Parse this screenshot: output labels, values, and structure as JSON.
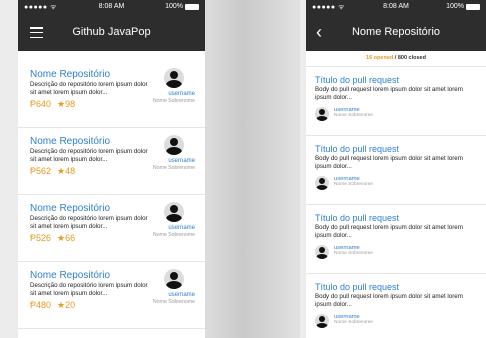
{
  "status": {
    "carrier": "●●●●● ᯤ",
    "time": "8:08 AM",
    "battery": "100%"
  },
  "left_screen": {
    "title": "Github JavaPop",
    "repos": [
      {
        "name": "Nome Repositório",
        "description": "Descrição do repositório lorem ipsum dolor sit amet lorem ipsum dolor...",
        "forks": "640",
        "stars": "98",
        "username": "username",
        "fullname": "Nome Sobrenome"
      },
      {
        "name": "Nome Repositório",
        "description": "Descrição do repositório lorem ipsum dolor sit amet lorem ipsum dolor...",
        "forks": "562",
        "stars": "48",
        "username": "username",
        "fullname": "Nome Sobrenome"
      },
      {
        "name": "Nome Repositório",
        "description": "Descrição do repositório lorem ipsum dolor sit amet lorem ipsum dolor...",
        "forks": "526",
        "stars": "66",
        "username": "username",
        "fullname": "Nome Sobrenome"
      },
      {
        "name": "Nome Repositório",
        "description": "Descrição do repositório lorem ipsum dolor sit amet lorem ipsum dolor...",
        "forks": "480",
        "stars": "20",
        "username": "username",
        "fullname": "Nome Sobrenome"
      }
    ]
  },
  "right_screen": {
    "title": "Nome Repositório",
    "summary": {
      "opened": "16 opened",
      "separator": " / ",
      "closed": "800 closed"
    },
    "pulls": [
      {
        "title": "Título do pull request",
        "body": "Body do pull request lorem ipsum dolor sit amet lorem ipsum dolor...",
        "username": "username",
        "fullname": "Nome Sobrenome"
      },
      {
        "title": "Título do pull request",
        "body": "Body do pull request lorem ipsum dolor sit amet lorem ipsum dolor...",
        "username": "username",
        "fullname": "Nome Sobrenome"
      },
      {
        "title": "Título do pull request",
        "body": "Body do pull request lorem ipsum dolor sit amet lorem ipsum dolor...",
        "username": "username",
        "fullname": "Nome Sobrenome"
      },
      {
        "title": "Título do pull request",
        "body": "Body do pull request lorem ipsum dolor sit amet lorem ipsum dolor...",
        "username": "username",
        "fullname": "Nome Sobrenome"
      }
    ]
  },
  "icons": {
    "fork": "fork-icon",
    "star": "star-icon",
    "menu": "hamburger-icon",
    "back": "chevron-left-icon"
  },
  "colors": {
    "bar": "#2d2d2d",
    "link": "#2f7fd0",
    "accent": "#e79b1c"
  }
}
